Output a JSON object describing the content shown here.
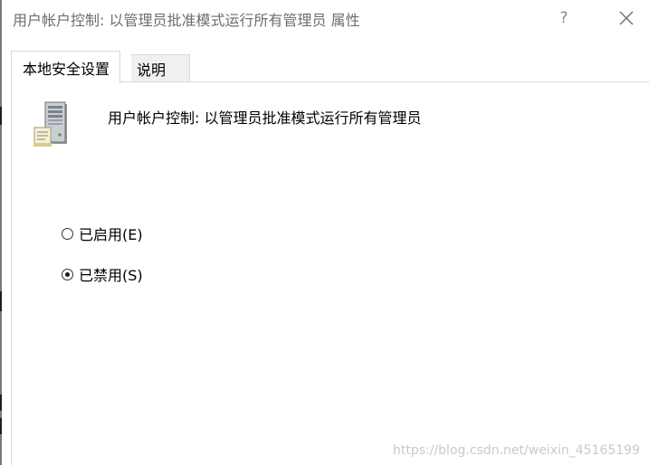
{
  "window": {
    "title": "用户帐户控制: 以管理员批准模式运行所有管理员 属性",
    "help_label": "?",
    "close_icon": "close-icon"
  },
  "tabs": [
    {
      "label": "本地安全设置",
      "active": true
    },
    {
      "label": "说明",
      "active": false
    }
  ],
  "policy": {
    "icon": "server-policy-icon",
    "title": "用户帐户控制: 以管理员批准模式运行所有管理员"
  },
  "options": [
    {
      "label": "已启用(E)",
      "checked": false
    },
    {
      "label": "已禁用(S)",
      "checked": true
    }
  ],
  "watermark": "https://blog.csdn.net/weixin_45165199",
  "colors": {
    "title_text": "#6d6d6d",
    "tab_inactive_bg": "#f0f0f0",
    "border": "#d9d9d9",
    "watermark": "#c9c9c9"
  }
}
